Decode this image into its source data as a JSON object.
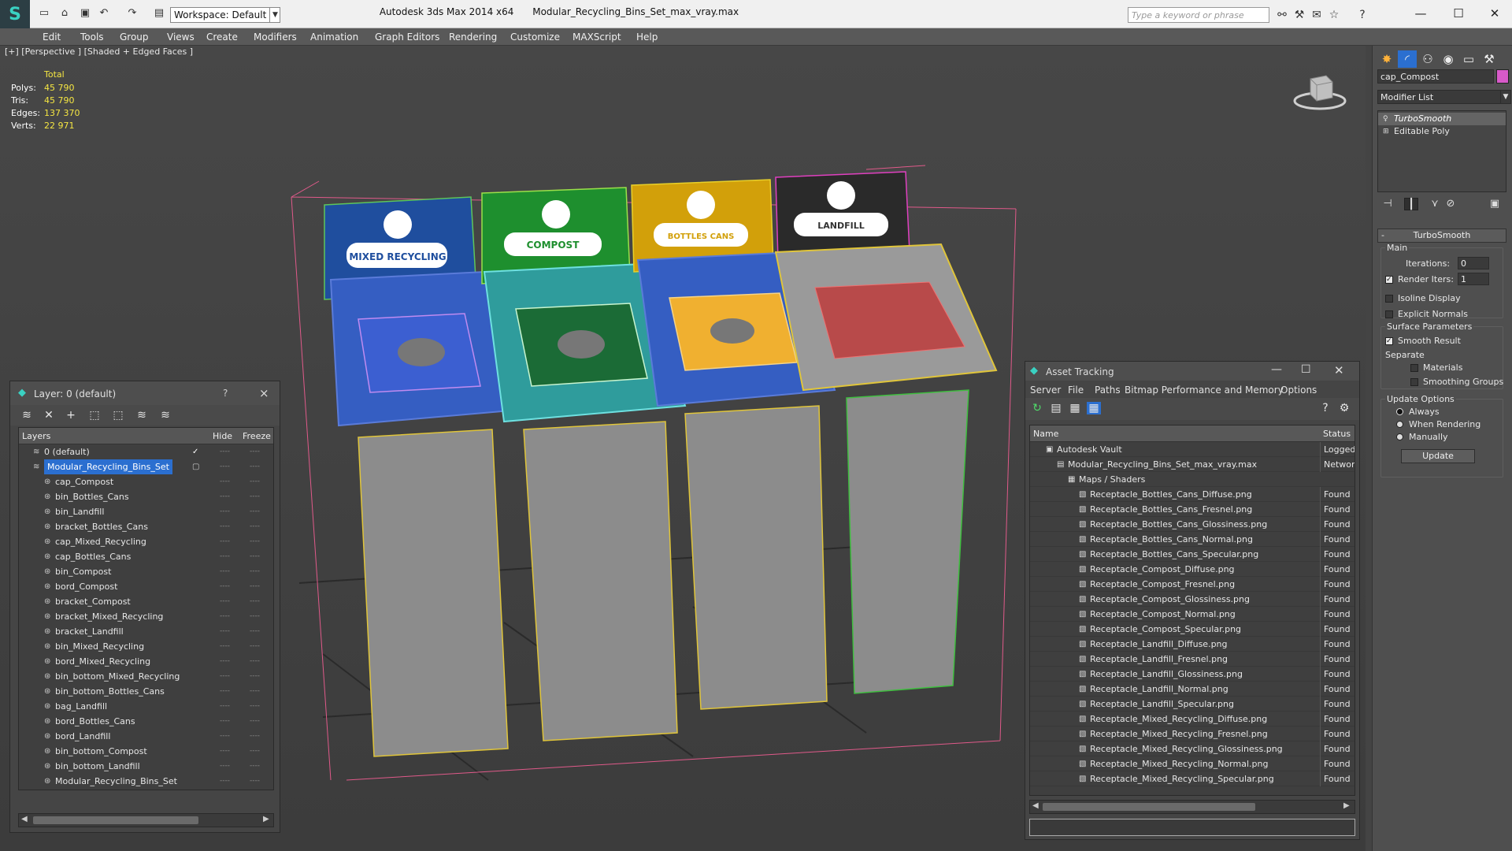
{
  "title_bar": {
    "app_title": "Autodesk 3ds Max  2014 x64",
    "file_title": "Modular_Recycling_Bins_Set_max_vray.max",
    "workspace_label": "Workspace: Default",
    "search_placeholder": "Type a keyword or phrase",
    "logo_glyph": "S"
  },
  "menu": [
    "Edit",
    "Tools",
    "Group",
    "Views",
    "Create",
    "Modifiers",
    "Animation",
    "Graph Editors",
    "Rendering",
    "Customize",
    "MAXScript",
    "Help"
  ],
  "viewport": {
    "label": "[+] [Perspective ] [Shaded + Edged Faces ]",
    "stats_header": "Total",
    "stats": [
      {
        "key": "Polys:",
        "value": "45 790"
      },
      {
        "key": "Tris:",
        "value": "45 790"
      },
      {
        "key": "Edges:",
        "value": "137 370"
      },
      {
        "key": "Verts:",
        "value": "22 971"
      }
    ],
    "bin_labels": [
      "MIXED RECYCLING",
      "COMPOST",
      "BOTTLES CANS",
      "LANDFILL"
    ],
    "bin_colors": [
      "#1f4e9e",
      "#1e8f2e",
      "#d2a00a",
      "#d41ea0"
    ]
  },
  "layer_panel": {
    "title": "Layer: 0 (default)",
    "help_label": "?",
    "close_label": "×",
    "columns": {
      "layers": "Layers",
      "hide": "Hide",
      "freeze": "Freeze"
    },
    "rows": [
      {
        "name": "0 (default)",
        "level": 0,
        "checked": "✓"
      },
      {
        "name": "Modular_Recycling_Bins_Set",
        "level": 0,
        "selected": true
      },
      {
        "name": "cap_Compost",
        "level": 1
      },
      {
        "name": "bin_Bottles_Cans",
        "level": 1
      },
      {
        "name": "bin_Landfill",
        "level": 1
      },
      {
        "name": "bracket_Bottles_Cans",
        "level": 1
      },
      {
        "name": "cap_Mixed_Recycling",
        "level": 1
      },
      {
        "name": "cap_Bottles_Cans",
        "level": 1
      },
      {
        "name": "bin_Compost",
        "level": 1
      },
      {
        "name": "bord_Compost",
        "level": 1
      },
      {
        "name": "bracket_Compost",
        "level": 1
      },
      {
        "name": "bracket_Mixed_Recycling",
        "level": 1
      },
      {
        "name": "bracket_Landfill",
        "level": 1
      },
      {
        "name": "bin_Mixed_Recycling",
        "level": 1
      },
      {
        "name": "bord_Mixed_Recycling",
        "level": 1
      },
      {
        "name": "bin_bottom_Mixed_Recycling",
        "level": 1
      },
      {
        "name": "bin_bottom_Bottles_Cans",
        "level": 1
      },
      {
        "name": "bag_Landfill",
        "level": 1
      },
      {
        "name": "bord_Bottles_Cans",
        "level": 1
      },
      {
        "name": "bord_Landfill",
        "level": 1
      },
      {
        "name": "bin_bottom_Compost",
        "level": 1
      },
      {
        "name": "bin_bottom_Landfill",
        "level": 1
      },
      {
        "name": "Modular_Recycling_Bins_Set",
        "level": 1
      }
    ],
    "cell_mark": "----"
  },
  "asset_panel": {
    "title": "Asset Tracking",
    "menu": [
      "Server",
      "File",
      "Paths",
      "Bitmap Performance and Memory",
      "Options"
    ],
    "columns": {
      "name": "Name",
      "status": "Status"
    },
    "rows": [
      {
        "name": "Autodesk Vault",
        "status": "Logged Out",
        "level": 0
      },
      {
        "name": "Modular_Recycling_Bins_Set_max_vray.max",
        "status": "Network",
        "level": 1
      },
      {
        "name": "Maps / Shaders",
        "status": "",
        "level": 2
      },
      {
        "name": "Receptacle_Bottles_Cans_Diffuse.png",
        "status": "Found",
        "level": 3
      },
      {
        "name": "Receptacle_Bottles_Cans_Fresnel.png",
        "status": "Found",
        "level": 3
      },
      {
        "name": "Receptacle_Bottles_Cans_Glossiness.png",
        "status": "Found",
        "level": 3
      },
      {
        "name": "Receptacle_Bottles_Cans_Normal.png",
        "status": "Found",
        "level": 3
      },
      {
        "name": "Receptacle_Bottles_Cans_Specular.png",
        "status": "Found",
        "level": 3
      },
      {
        "name": "Receptacle_Compost_Diffuse.png",
        "status": "Found",
        "level": 3
      },
      {
        "name": "Receptacle_Compost_Fresnel.png",
        "status": "Found",
        "level": 3
      },
      {
        "name": "Receptacle_Compost_Glossiness.png",
        "status": "Found",
        "level": 3
      },
      {
        "name": "Receptacle_Compost_Normal.png",
        "status": "Found",
        "level": 3
      },
      {
        "name": "Receptacle_Compost_Specular.png",
        "status": "Found",
        "level": 3
      },
      {
        "name": "Receptacle_Landfill_Diffuse.png",
        "status": "Found",
        "level": 3
      },
      {
        "name": "Receptacle_Landfill_Fresnel.png",
        "status": "Found",
        "level": 3
      },
      {
        "name": "Receptacle_Landfill_Glossiness.png",
        "status": "Found",
        "level": 3
      },
      {
        "name": "Receptacle_Landfill_Normal.png",
        "status": "Found",
        "level": 3
      },
      {
        "name": "Receptacle_Landfill_Specular.png",
        "status": "Found",
        "level": 3
      },
      {
        "name": "Receptacle_Mixed_Recycling_Diffuse.png",
        "status": "Found",
        "level": 3
      },
      {
        "name": "Receptacle_Mixed_Recycling_Fresnel.png",
        "status": "Found",
        "level": 3
      },
      {
        "name": "Receptacle_Mixed_Recycling_Glossiness.png",
        "status": "Found",
        "level": 3
      },
      {
        "name": "Receptacle_Mixed_Recycling_Normal.png",
        "status": "Found",
        "level": 3
      },
      {
        "name": "Receptacle_Mixed_Recycling_Specular.png",
        "status": "Found",
        "level": 3
      }
    ]
  },
  "command_panel": {
    "object_name": "cap_Compost",
    "object_color": "#d85ac9",
    "modifier_list_label": "Modifier List",
    "stack": [
      "TurboSmooth",
      "Editable Poly"
    ],
    "rollout_title": "TurboSmooth",
    "main_label": "Main",
    "iterations_label": "Iterations:",
    "iterations_value": "0",
    "render_iters_label": "Render Iters:",
    "render_iters_value": "1",
    "isoline_label": "Isoline Display",
    "explicit_normals_label": "Explicit Normals",
    "surface_params_label": "Surface Parameters",
    "smooth_result_label": "Smooth Result",
    "separate_label": "Separate",
    "materials_label": "Materials",
    "smoothing_groups_label": "Smoothing Groups",
    "update_options_label": "Update Options",
    "always_label": "Always",
    "when_rendering_label": "When Rendering",
    "manually_label": "Manually",
    "update_button": "Update"
  },
  "accent_color": "#2b6fd0"
}
